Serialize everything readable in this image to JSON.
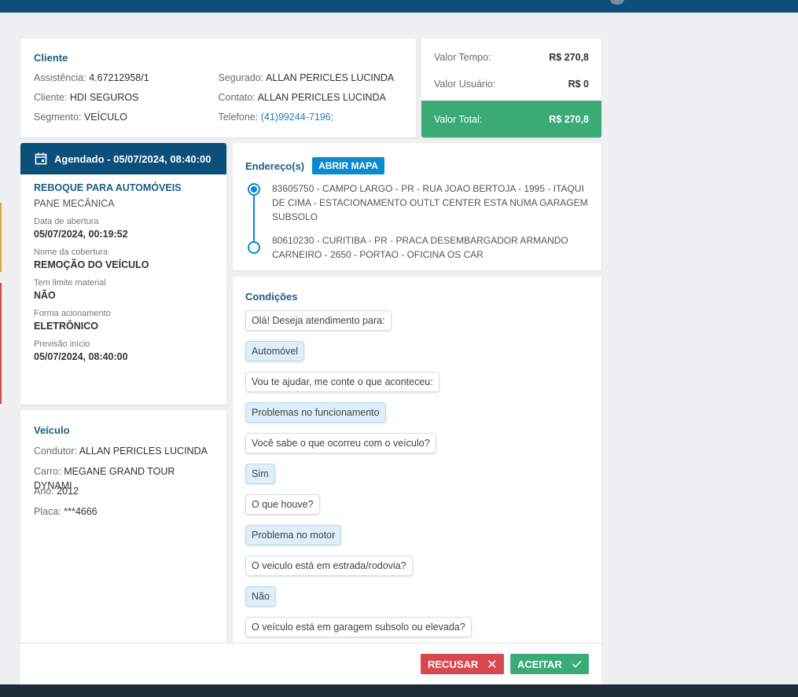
{
  "cliente": {
    "title": "Cliente",
    "assistencia_label": "Assistência:",
    "assistencia": "4.67212958/1",
    "cliente_label": "Cliente:",
    "cliente": "HDI SEGUROS",
    "segmento_label": "Segmento:",
    "segmento": "VEÍCULO",
    "segurado_label": "Segurado:",
    "segurado": "ALLAN PERICLES LUCINDA",
    "contato_label": "Contato:",
    "contato": "ALLAN PERICLES LUCINDA",
    "telefone_label": "Telefone:",
    "telefone": "(41)99244-7196;"
  },
  "valores": {
    "tempo_label": "Valor Tempo:",
    "tempo": "R$ 270,8",
    "usuario_label": "Valor Usuário:",
    "usuario": "R$ 0",
    "total_label": "Valor Total:",
    "total": "R$ 270,8"
  },
  "agendamento": {
    "header": "Agendado - 05/07/2024, 08:40:00",
    "tipo": "REBOQUE PARA AUTOMÓVEIS",
    "subtipo": "PANE MECÂNICA",
    "fields": [
      {
        "label": "Data de abertura",
        "value": "05/07/2024, 00:19:52"
      },
      {
        "label": "Nome da cobertura",
        "value": "REMOÇÃO DO VEÍCULO"
      },
      {
        "label": "Tem limite material",
        "value": "NÃO"
      },
      {
        "label": "Forma acionamento",
        "value": "ELETRÔNICO"
      },
      {
        "label": "Previsão início",
        "value": "05/07/2024, 08:40:00"
      }
    ]
  },
  "veiculo": {
    "title": "Veículo",
    "condutor_label": "Condutor:",
    "condutor": "ALLAN PERICLES LUCINDA",
    "carro_label": "Carro:",
    "carro": "MEGANE GRAND TOUR DYNAMI",
    "ano_label": "Ano:",
    "ano": "2012",
    "placa_label": "Placa:",
    "placa": "***4666"
  },
  "endereco": {
    "title": "Endereço(s)",
    "map_button": "ABRIR MAPA",
    "origem": "83605750 - CAMPO LARGO - PR - RUA JOAO BERTOJA - 1995 - ITAQUI DE CIMA - ESTACIONAMENTO OUTLT CENTER ESTA NUMA GARAGEM SUBSOLO",
    "destino": "80610230 - CURITIBA - PR - PRACA DESEMBARGADOR ARMANDO CARNEIRO - 2650 - PORTAO - OFICINA OS CAR"
  },
  "condicoes": {
    "title": "Condições",
    "messages": [
      {
        "text": "Olá! Deseja atendimento para:",
        "type": "q"
      },
      {
        "text": "Automóvel",
        "type": "a"
      },
      {
        "text": "Vou te ajudar, me conte o que aconteceu:",
        "type": "q"
      },
      {
        "text": "Problemas no funcionamento",
        "type": "a"
      },
      {
        "text": "Você sabe o que ocorreu com o veículo?",
        "type": "q"
      },
      {
        "text": "Sim",
        "type": "a"
      },
      {
        "text": "O que houve?",
        "type": "q"
      },
      {
        "text": "Problema no motor",
        "type": "a"
      },
      {
        "text": "O veiculo está em estrada/rodovia?",
        "type": "q"
      },
      {
        "text": "Não",
        "type": "a"
      },
      {
        "text": "O veículo está em garagem subsolo ou elevada?",
        "type": "q"
      }
    ]
  },
  "actions": {
    "recusar": "RECUSAR",
    "aceitar": "ACEITAR"
  },
  "colors": {
    "primary": "#0b4f7a",
    "accent": "#0a8bd0",
    "success": "#3aaa77",
    "danger": "#d9474f"
  },
  "icons": {
    "calendar": "calendar-icon",
    "close": "close-icon",
    "check": "check-icon"
  }
}
